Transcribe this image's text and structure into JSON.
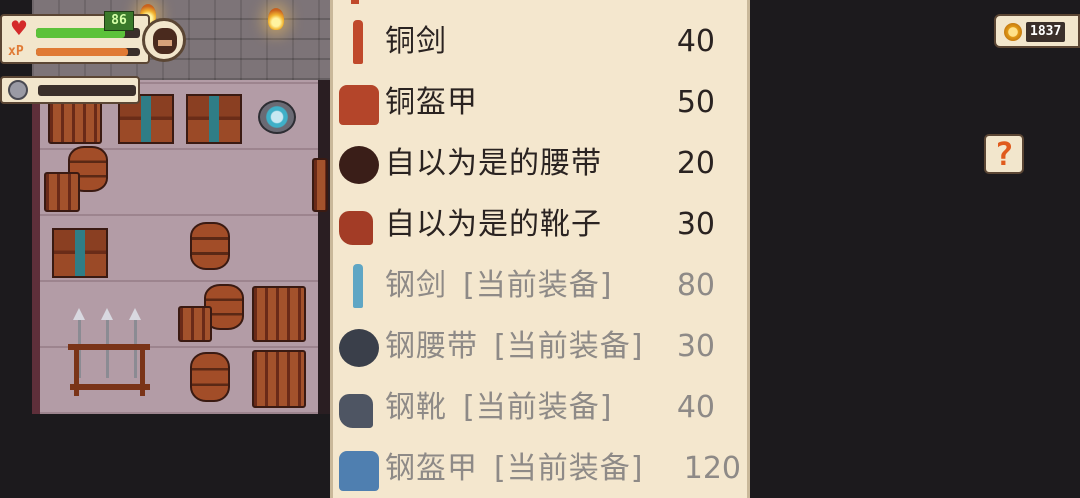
{
  "hud": {
    "hp_value": "86",
    "hp_fraction": 0.86,
    "xp_fraction": 0.88,
    "stamina_fraction": 0.0,
    "hp_icon": "heart-icon",
    "xp_label": "xP"
  },
  "currency": {
    "coins": "1837",
    "icon": "coin-icon"
  },
  "help": {
    "label": "?"
  },
  "shop": {
    "items": [
      {
        "name": "铜剑",
        "tag": "",
        "price": "40",
        "equipped": false,
        "icon": "copper-sword-icon",
        "color": "#c0492b"
      },
      {
        "name": "铜盔甲",
        "tag": "",
        "price": "50",
        "equipped": false,
        "icon": "copper-armor-icon",
        "color": "#b4452a"
      },
      {
        "name": "自以为是的腰带",
        "tag": "",
        "price": "20",
        "equipped": false,
        "icon": "belt-icon",
        "color": "#3a1e18"
      },
      {
        "name": "自以为是的靴子",
        "tag": "",
        "price": "30",
        "equipped": false,
        "icon": "boots-icon",
        "color": "#a33c26"
      },
      {
        "name": "钢剑",
        "tag": "[当前装备]",
        "price": "80",
        "equipped": true,
        "icon": "steel-sword-icon",
        "color": "#5fa6c4"
      },
      {
        "name": "钢腰带",
        "tag": "[当前装备]",
        "price": "30",
        "equipped": true,
        "icon": "steel-belt-icon",
        "color": "#3a3f4a"
      },
      {
        "name": "钢靴",
        "tag": "[当前装备]",
        "price": "40",
        "equipped": true,
        "icon": "steel-boots-icon",
        "color": "#4e5563"
      },
      {
        "name": "钢盔甲",
        "tag": "[当前装备]",
        "price": "120",
        "equipped": true,
        "icon": "steel-armor-icon",
        "color": "#4f7fb0"
      }
    ]
  },
  "colors": {
    "panel_bg": "#f4e7ce",
    "text": "#2a2321",
    "equipped_text": "#8e8a87",
    "hp_green": "#5cc23a",
    "xp_orange": "#e07a34"
  }
}
